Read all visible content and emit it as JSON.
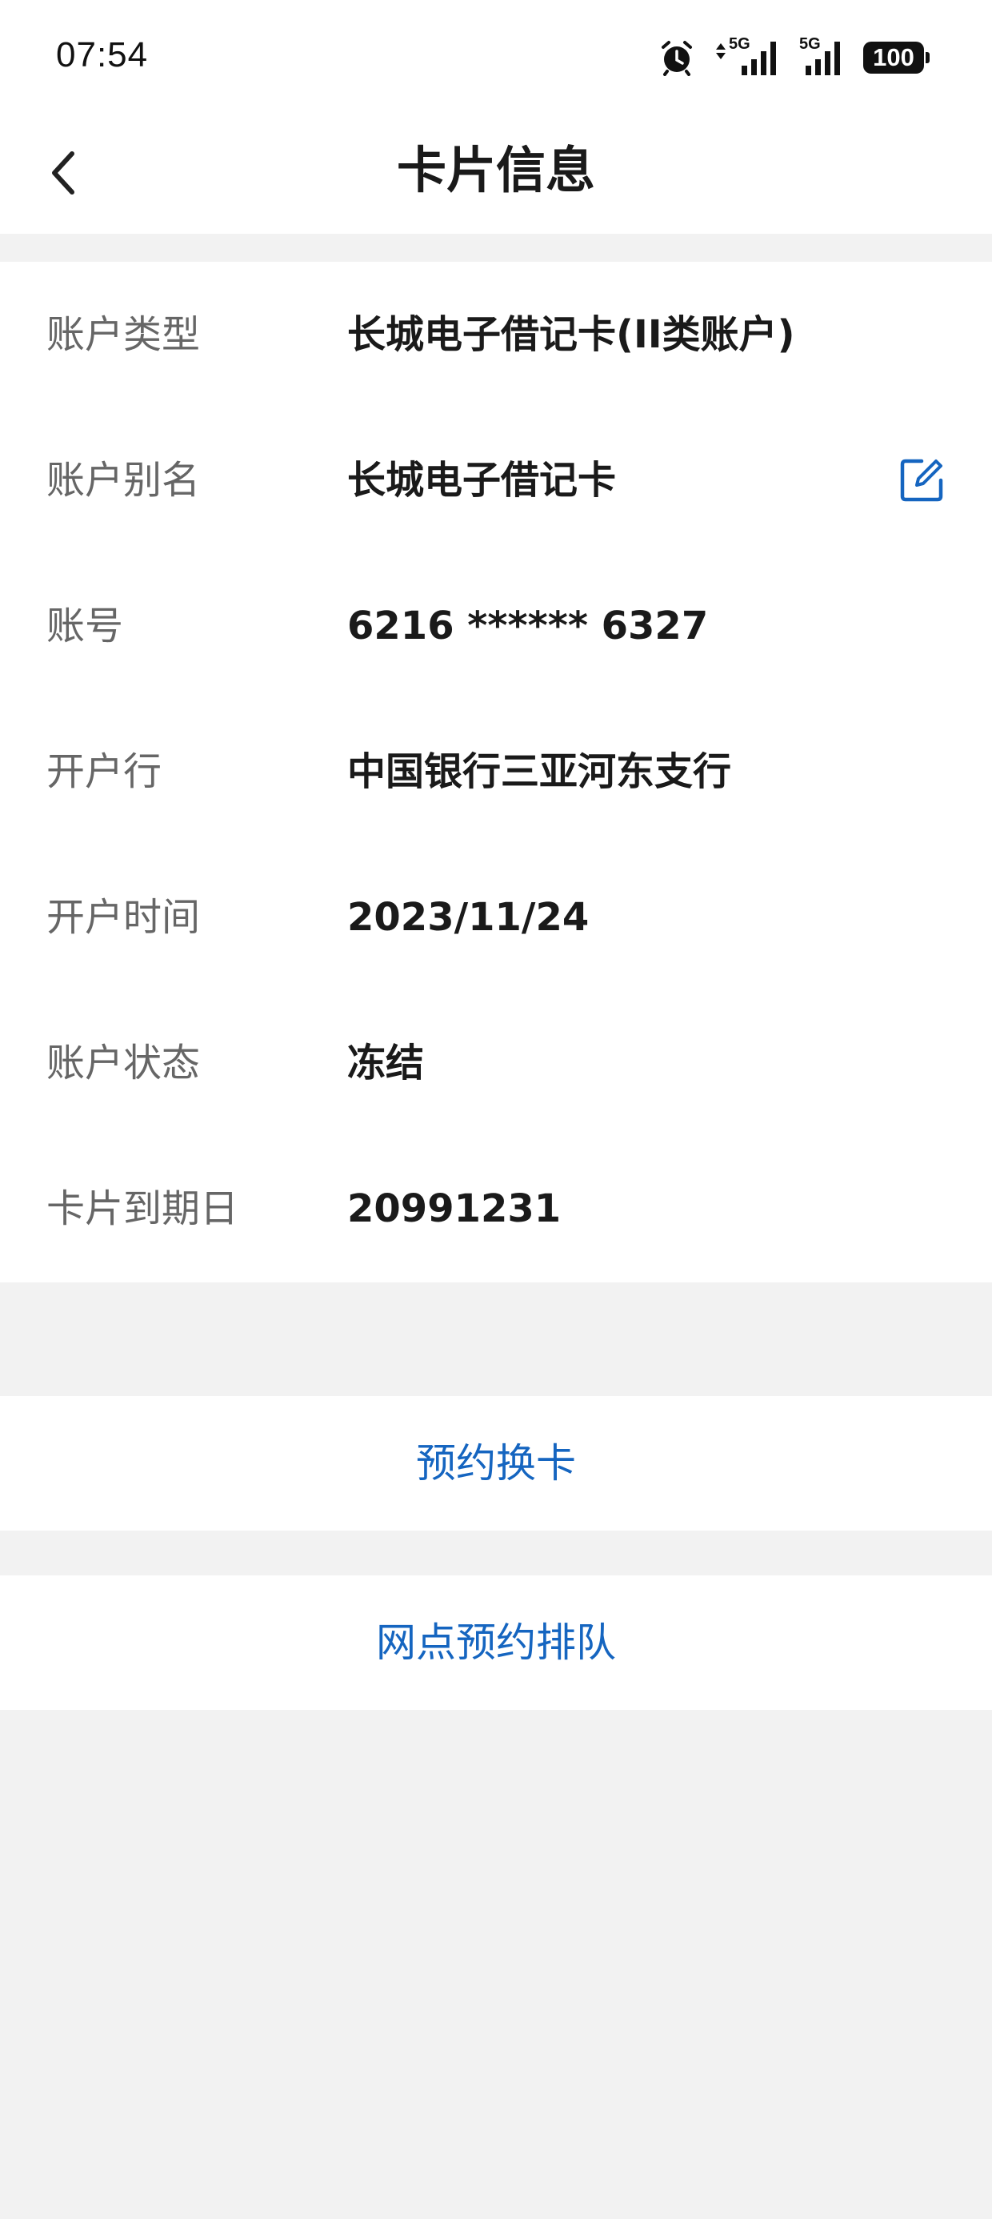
{
  "status_bar": {
    "time": "07:54",
    "network_1": "5G",
    "network_2": "5G",
    "battery": "100",
    "icons": [
      "alarm-icon",
      "data-arrows-icon",
      "signal-icon",
      "signal-icon",
      "battery-icon"
    ]
  },
  "nav": {
    "title": "卡片信息",
    "back_icon": "chevron-left-icon"
  },
  "card_info": {
    "rows": [
      {
        "label": "账户类型",
        "value": "长城电子借记卡(II类账户)"
      },
      {
        "label": "账户别名",
        "value": "长城电子借记卡",
        "action_icon": "edit-icon"
      },
      {
        "label": "账号",
        "value": "6216 ****** 6327"
      },
      {
        "label": "开户行",
        "value": "中国银行三亚河东支行"
      },
      {
        "label": "开户时间",
        "value": "2023/11/24"
      },
      {
        "label": "账户状态",
        "value": "冻结"
      },
      {
        "label": "卡片到期日",
        "value": "20991231"
      }
    ]
  },
  "actions": {
    "replace_card": "预约换卡",
    "branch_queue": "网点预约排队"
  },
  "colors": {
    "accent": "#1565c0",
    "background": "#f2f2f2",
    "label": "#666666",
    "value": "#1a1a1a"
  }
}
